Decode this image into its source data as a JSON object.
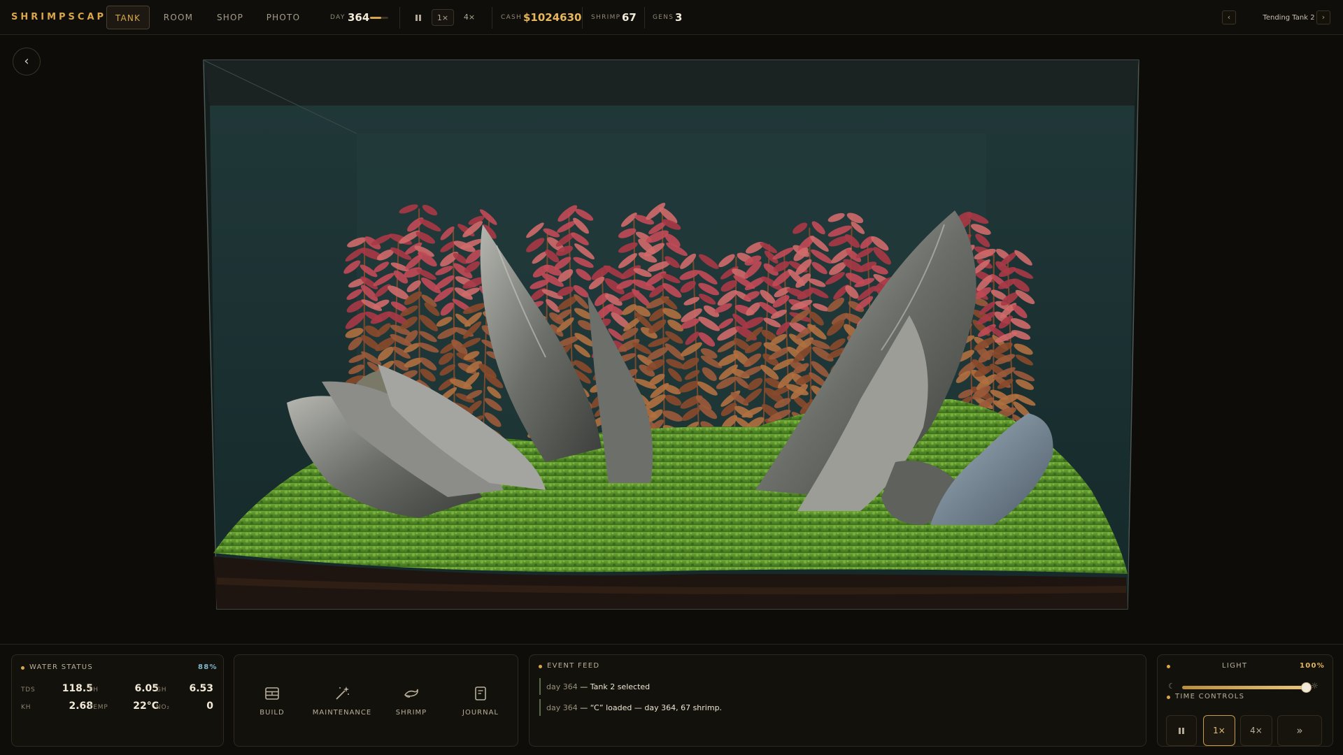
{
  "app": {
    "brand": "SHRIMPSCAPE"
  },
  "nav": {
    "tabs": [
      {
        "label": "TANK",
        "active": true
      },
      {
        "label": "ROOM"
      },
      {
        "label": "SHOP"
      },
      {
        "label": "PHOTO"
      }
    ]
  },
  "stats": {
    "day_label": "DAY",
    "day": "364",
    "day_progress": 0.6,
    "cash_label": "CASH",
    "cash": "$1024630",
    "shrimp_label": "SHRIMP",
    "shrimp": "67",
    "gens_label": "GENS",
    "gens": "3"
  },
  "speed": {
    "pause_icon": "pause-icon",
    "speed1": "1×",
    "speed4": "4×",
    "active": "1×"
  },
  "tank_nav": {
    "prev": "‹",
    "next": "›",
    "name": "Tending Tank 2"
  },
  "water_status": {
    "title": "WATER STATUS",
    "percent": "88%",
    "rows": [
      {
        "label": "TDS",
        "value": "118.5"
      },
      {
        "label": "PH",
        "value": "6.05"
      },
      {
        "label": "GH",
        "value": "6.53"
      },
      {
        "label": "KH",
        "value": "2.68"
      },
      {
        "label": "TEMP",
        "value": "22°C"
      },
      {
        "label": "NO₂",
        "value": "0"
      }
    ]
  },
  "tools": [
    {
      "label": "BUILD",
      "icon": "build-icon"
    },
    {
      "label": "MAINTENANCE",
      "icon": "wand-icon"
    },
    {
      "label": "SHRIMP",
      "icon": "shrimp-icon"
    },
    {
      "label": "JOURNAL",
      "icon": "journal-icon"
    }
  ],
  "events": {
    "title": "EVENT FEED",
    "items": [
      {
        "day": "day 364",
        "text": " — Tank 2 selected"
      },
      {
        "day": "day 364",
        "text": " — “C” loaded — day 364, 67 shrimp."
      }
    ]
  },
  "light": {
    "title": "LIGHT",
    "percent_label": "100%",
    "level": 1.0
  },
  "time_controls": {
    "title": "TIME CONTROLS",
    "buttons": [
      {
        "label": "⏸",
        "icon": "pause-icon"
      },
      {
        "label": "1×",
        "active": true
      },
      {
        "label": "4×"
      },
      {
        "label": "»",
        "icon": "fast-forward-icon"
      }
    ]
  },
  "colors": {
    "accent": "#d9a64a",
    "water": "#1b2f30",
    "moss": "#5a9a2c",
    "plant_red": "#b4444e",
    "rock": "#7d7f7a"
  }
}
